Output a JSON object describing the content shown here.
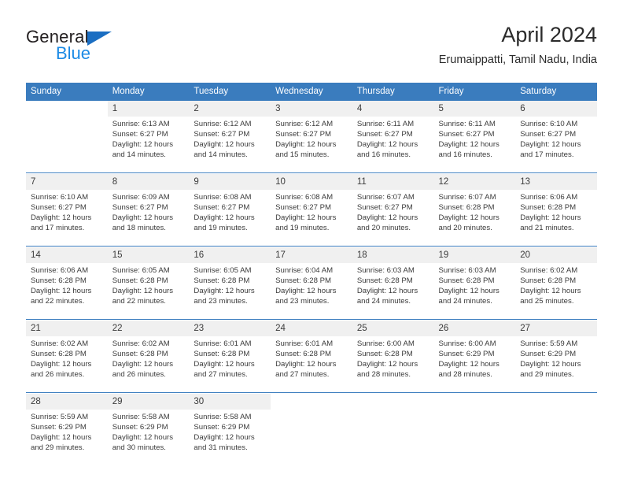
{
  "brand": {
    "name_part1": "General",
    "name_part2": "Blue",
    "logo_icon": "blue-triangle-icon"
  },
  "header": {
    "title": "April 2024",
    "location": "Erumaippatti, Tamil Nadu, India"
  },
  "colors": {
    "header_blue": "#3a7cbe",
    "brand_blue": "#1b8ae5",
    "logo_blue": "#1b6ec2",
    "number_band": "#f0f0f0",
    "text": "#3b3b3b"
  },
  "labels": {
    "sunrise_prefix": "Sunrise:",
    "sunset_prefix": "Sunset:",
    "daylight_prefix": "Daylight:"
  },
  "calendar": {
    "weekday_headers": [
      "Sunday",
      "Monday",
      "Tuesday",
      "Wednesday",
      "Thursday",
      "Friday",
      "Saturday"
    ],
    "weeks": [
      {
        "days": [
          {
            "date": "",
            "empty": true,
            "lines": []
          },
          {
            "date": "1",
            "empty": false,
            "lines": [
              "Sunrise: 6:13 AM",
              "Sunset: 6:27 PM",
              "Daylight: 12 hours",
              "and 14 minutes."
            ]
          },
          {
            "date": "2",
            "empty": false,
            "lines": [
              "Sunrise: 6:12 AM",
              "Sunset: 6:27 PM",
              "Daylight: 12 hours",
              "and 14 minutes."
            ]
          },
          {
            "date": "3",
            "empty": false,
            "lines": [
              "Sunrise: 6:12 AM",
              "Sunset: 6:27 PM",
              "Daylight: 12 hours",
              "and 15 minutes."
            ]
          },
          {
            "date": "4",
            "empty": false,
            "lines": [
              "Sunrise: 6:11 AM",
              "Sunset: 6:27 PM",
              "Daylight: 12 hours",
              "and 16 minutes."
            ]
          },
          {
            "date": "5",
            "empty": false,
            "lines": [
              "Sunrise: 6:11 AM",
              "Sunset: 6:27 PM",
              "Daylight: 12 hours",
              "and 16 minutes."
            ]
          },
          {
            "date": "6",
            "empty": false,
            "lines": [
              "Sunrise: 6:10 AM",
              "Sunset: 6:27 PM",
              "Daylight: 12 hours",
              "and 17 minutes."
            ]
          }
        ]
      },
      {
        "days": [
          {
            "date": "7",
            "empty": false,
            "lines": [
              "Sunrise: 6:10 AM",
              "Sunset: 6:27 PM",
              "Daylight: 12 hours",
              "and 17 minutes."
            ]
          },
          {
            "date": "8",
            "empty": false,
            "lines": [
              "Sunrise: 6:09 AM",
              "Sunset: 6:27 PM",
              "Daylight: 12 hours",
              "and 18 minutes."
            ]
          },
          {
            "date": "9",
            "empty": false,
            "lines": [
              "Sunrise: 6:08 AM",
              "Sunset: 6:27 PM",
              "Daylight: 12 hours",
              "and 19 minutes."
            ]
          },
          {
            "date": "10",
            "empty": false,
            "lines": [
              "Sunrise: 6:08 AM",
              "Sunset: 6:27 PM",
              "Daylight: 12 hours",
              "and 19 minutes."
            ]
          },
          {
            "date": "11",
            "empty": false,
            "lines": [
              "Sunrise: 6:07 AM",
              "Sunset: 6:27 PM",
              "Daylight: 12 hours",
              "and 20 minutes."
            ]
          },
          {
            "date": "12",
            "empty": false,
            "lines": [
              "Sunrise: 6:07 AM",
              "Sunset: 6:28 PM",
              "Daylight: 12 hours",
              "and 20 minutes."
            ]
          },
          {
            "date": "13",
            "empty": false,
            "lines": [
              "Sunrise: 6:06 AM",
              "Sunset: 6:28 PM",
              "Daylight: 12 hours",
              "and 21 minutes."
            ]
          }
        ]
      },
      {
        "days": [
          {
            "date": "14",
            "empty": false,
            "lines": [
              "Sunrise: 6:06 AM",
              "Sunset: 6:28 PM",
              "Daylight: 12 hours",
              "and 22 minutes."
            ]
          },
          {
            "date": "15",
            "empty": false,
            "lines": [
              "Sunrise: 6:05 AM",
              "Sunset: 6:28 PM",
              "Daylight: 12 hours",
              "and 22 minutes."
            ]
          },
          {
            "date": "16",
            "empty": false,
            "lines": [
              "Sunrise: 6:05 AM",
              "Sunset: 6:28 PM",
              "Daylight: 12 hours",
              "and 23 minutes."
            ]
          },
          {
            "date": "17",
            "empty": false,
            "lines": [
              "Sunrise: 6:04 AM",
              "Sunset: 6:28 PM",
              "Daylight: 12 hours",
              "and 23 minutes."
            ]
          },
          {
            "date": "18",
            "empty": false,
            "lines": [
              "Sunrise: 6:03 AM",
              "Sunset: 6:28 PM",
              "Daylight: 12 hours",
              "and 24 minutes."
            ]
          },
          {
            "date": "19",
            "empty": false,
            "lines": [
              "Sunrise: 6:03 AM",
              "Sunset: 6:28 PM",
              "Daylight: 12 hours",
              "and 24 minutes."
            ]
          },
          {
            "date": "20",
            "empty": false,
            "lines": [
              "Sunrise: 6:02 AM",
              "Sunset: 6:28 PM",
              "Daylight: 12 hours",
              "and 25 minutes."
            ]
          }
        ]
      },
      {
        "days": [
          {
            "date": "21",
            "empty": false,
            "lines": [
              "Sunrise: 6:02 AM",
              "Sunset: 6:28 PM",
              "Daylight: 12 hours",
              "and 26 minutes."
            ]
          },
          {
            "date": "22",
            "empty": false,
            "lines": [
              "Sunrise: 6:02 AM",
              "Sunset: 6:28 PM",
              "Daylight: 12 hours",
              "and 26 minutes."
            ]
          },
          {
            "date": "23",
            "empty": false,
            "lines": [
              "Sunrise: 6:01 AM",
              "Sunset: 6:28 PM",
              "Daylight: 12 hours",
              "and 27 minutes."
            ]
          },
          {
            "date": "24",
            "empty": false,
            "lines": [
              "Sunrise: 6:01 AM",
              "Sunset: 6:28 PM",
              "Daylight: 12 hours",
              "and 27 minutes."
            ]
          },
          {
            "date": "25",
            "empty": false,
            "lines": [
              "Sunrise: 6:00 AM",
              "Sunset: 6:28 PM",
              "Daylight: 12 hours",
              "and 28 minutes."
            ]
          },
          {
            "date": "26",
            "empty": false,
            "lines": [
              "Sunrise: 6:00 AM",
              "Sunset: 6:29 PM",
              "Daylight: 12 hours",
              "and 28 minutes."
            ]
          },
          {
            "date": "27",
            "empty": false,
            "lines": [
              "Sunrise: 5:59 AM",
              "Sunset: 6:29 PM",
              "Daylight: 12 hours",
              "and 29 minutes."
            ]
          }
        ]
      },
      {
        "days": [
          {
            "date": "28",
            "empty": false,
            "lines": [
              "Sunrise: 5:59 AM",
              "Sunset: 6:29 PM",
              "Daylight: 12 hours",
              "and 29 minutes."
            ]
          },
          {
            "date": "29",
            "empty": false,
            "lines": [
              "Sunrise: 5:58 AM",
              "Sunset: 6:29 PM",
              "Daylight: 12 hours",
              "and 30 minutes."
            ]
          },
          {
            "date": "30",
            "empty": false,
            "lines": [
              "Sunrise: 5:58 AM",
              "Sunset: 6:29 PM",
              "Daylight: 12 hours",
              "and 31 minutes."
            ]
          },
          {
            "date": "",
            "empty": true,
            "lines": []
          },
          {
            "date": "",
            "empty": true,
            "lines": []
          },
          {
            "date": "",
            "empty": true,
            "lines": []
          },
          {
            "date": "",
            "empty": true,
            "lines": []
          }
        ]
      }
    ]
  }
}
